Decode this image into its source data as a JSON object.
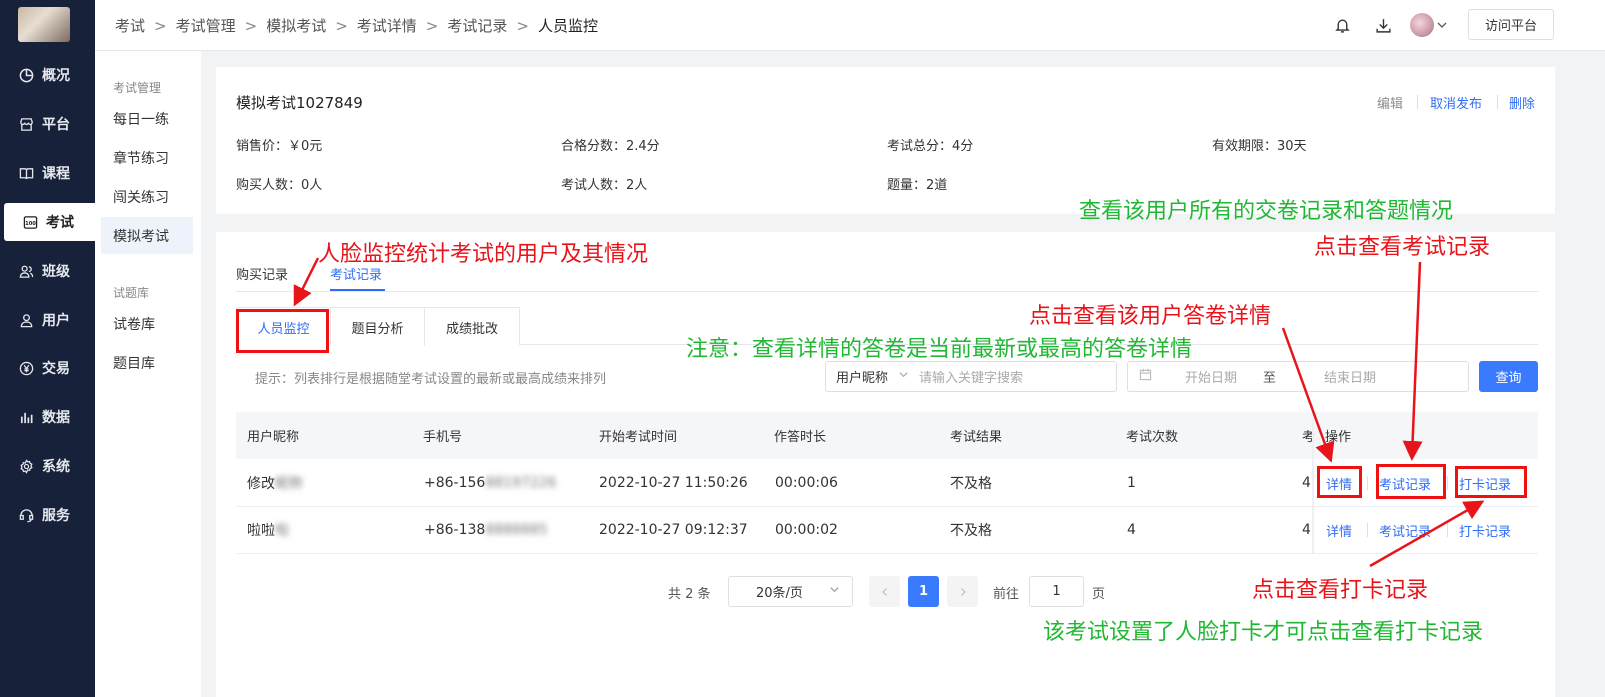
{
  "nav": {
    "items": [
      {
        "label": "概况",
        "icon": "pie-chart-icon"
      },
      {
        "label": "平台",
        "icon": "store-icon"
      },
      {
        "label": "课程",
        "icon": "book-icon"
      },
      {
        "label": "考试",
        "icon": "exam-icon"
      },
      {
        "label": "班级",
        "icon": "group-icon"
      },
      {
        "label": "用户",
        "icon": "user-icon"
      },
      {
        "label": "交易",
        "icon": "yen-icon"
      },
      {
        "label": "数据",
        "icon": "bar-chart-icon"
      },
      {
        "label": "系统",
        "icon": "gear-icon"
      },
      {
        "label": "服务",
        "icon": "service-icon"
      }
    ],
    "active": "考试"
  },
  "header": {
    "breadcrumb": [
      "考试",
      "考试管理",
      "模拟考试",
      "考试详情",
      "考试记录",
      "人员监控"
    ],
    "visit_button": "访问平台"
  },
  "submenu": {
    "group1": "考试管理",
    "items1": [
      "每日一练",
      "章节练习",
      "闯关练习",
      "模拟考试"
    ],
    "group2": "试题库",
    "items2": [
      "试卷库",
      "题目库"
    ]
  },
  "exam": {
    "title": "模拟考试1027849",
    "actions": {
      "edit": "编辑",
      "unpublish": "取消发布",
      "delete": "删除"
    },
    "info": {
      "price": "销售价：￥0元",
      "pass_score": "合格分数：2.4分",
      "total_score": "考试总分：4分",
      "validity": "有效期限：30天",
      "buyers": "购买人数：0人",
      "examinees": "考试人数：2人",
      "questions": "题量：2道"
    }
  },
  "tabs": {
    "purchase": "购买记录",
    "exam_records": "考试记录"
  },
  "subtabs": [
    "人员监控",
    "题目分析",
    "成绩批改"
  ],
  "filter": {
    "hint": "提示：列表排行是根据随堂考试设置的最新或最高成绩来排列",
    "select_label": "用户昵称",
    "search_placeholder": "请输入关键字搜索",
    "start_date": "开始日期",
    "to": "至",
    "end_date": "结束日期",
    "query_button": "查询"
  },
  "table": {
    "columns": [
      "用户昵称",
      "手机号",
      "开始考试时间",
      "作答时长",
      "考试结果",
      "考试次数",
      "考",
      "操作"
    ],
    "rows": [
      {
        "nickname": "修改",
        "nickname_blur": "昵称",
        "phone": "+86-156",
        "phone_blur": "88197226",
        "start": "2022-10-27 11:50:26",
        "duration": "00:00:06",
        "result": "不及格",
        "times": "1",
        "extra": "4"
      },
      {
        "nickname": "啦啦",
        "nickname_blur": "啦",
        "phone": "+86-138",
        "phone_blur": "8888885",
        "start": "2022-10-27 09:12:37",
        "duration": "00:00:02",
        "result": "不及格",
        "times": "4",
        "extra": "4"
      }
    ],
    "ops": {
      "detail": "详情",
      "exam_record": "考试记录",
      "checkin_record": "打卡记录"
    }
  },
  "pager": {
    "total": "共 2 条",
    "page_size": "20条/页",
    "current": "1",
    "goto": "前往",
    "goto_value": "1",
    "page_unit": "页"
  },
  "annotations": {
    "face_monitor": "人脸监控统计考试的用户及其情况",
    "view_all": "查看该用户所有的交卷记录和答题情况",
    "click_exam_record": "点击查看考试记录",
    "click_detail": "点击查看该用户答卷详情",
    "note": "注意：查看详情的答卷是当前最新或最高的答卷详情",
    "click_checkin": "点击查看打卡记录",
    "checkin_note": "该考试设置了人脸打卡才可点击查看打卡记录"
  },
  "colors": {
    "nav_bg": "#18213a",
    "primary": "#3a7afe",
    "annotation_red": "#e8141a",
    "annotation_green": "#20b833"
  }
}
